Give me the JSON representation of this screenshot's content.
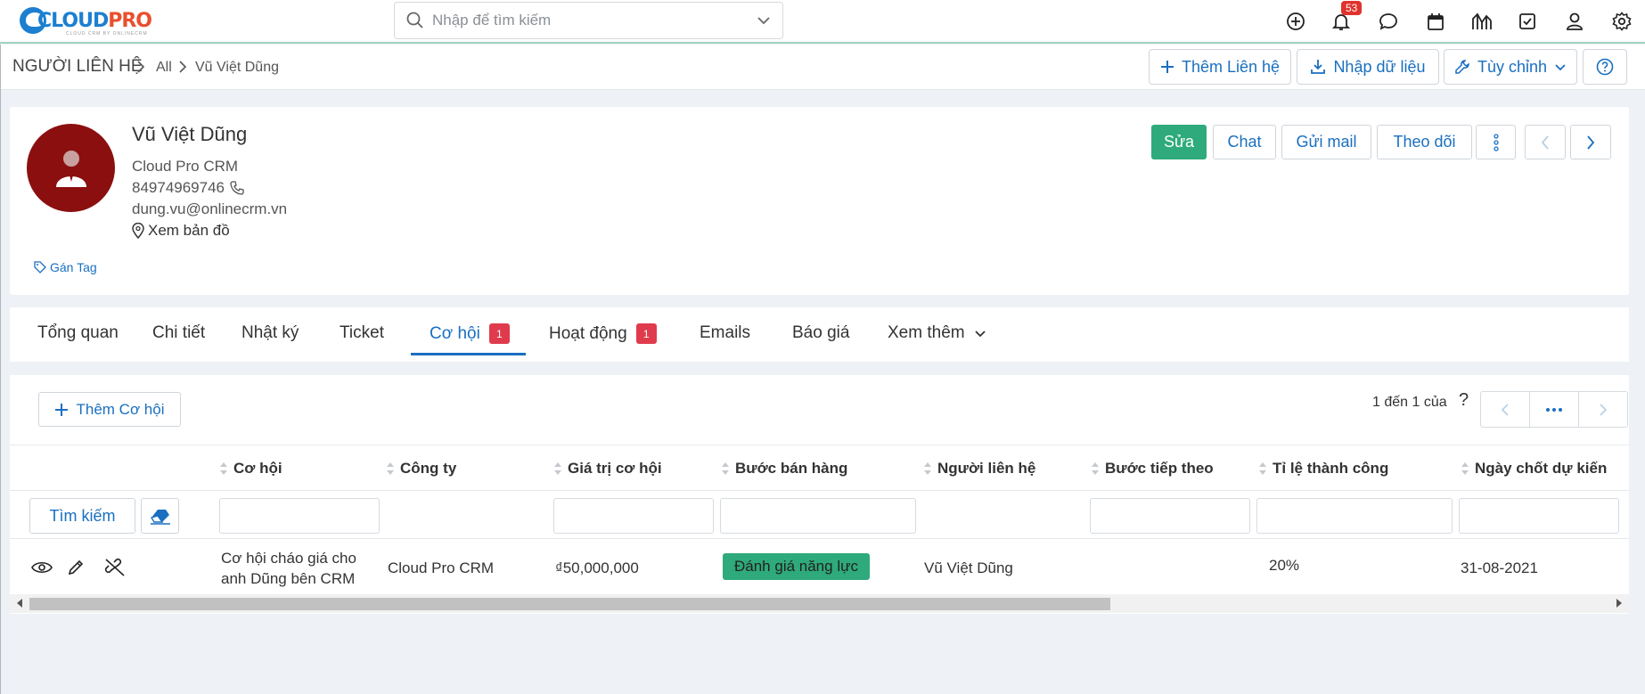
{
  "app": {
    "logo_text_a": "CLOUD",
    "logo_text_b": "PRO",
    "logo_tagline": "CLOUD CRM BY ONLINECRM",
    "brand_colors": {
      "blue": "#1c7fd0",
      "orange": "#e94f2d"
    }
  },
  "search": {
    "placeholder": "Nhập để tìm kiếm"
  },
  "topbar": {
    "icons": [
      "add-circle-icon",
      "bell-icon",
      "chat-bubble-icon",
      "calendar-icon",
      "chart-icon",
      "checkbox-icon",
      "user-icon",
      "settings-icon"
    ],
    "notification_count": "53"
  },
  "breadcrumb": {
    "module": "NGƯỜI LIÊN HỆ",
    "filter": "All",
    "record": "Vũ Việt Dũng"
  },
  "header_actions": {
    "add_contact": "Thêm Liên hệ",
    "import": "Nhập dữ liệu",
    "customize": "Tùy chỉnh"
  },
  "contact": {
    "name": "Vũ Việt Dũng",
    "company": "Cloud Pro CRM",
    "phone": "84974969746",
    "email": "dung.vu@onlinecrm.vn",
    "map": "Xem bản đồ",
    "tag": "Gán Tag",
    "avatar_color": "#8b0f0f"
  },
  "record_actions": {
    "edit": "Sửa",
    "chat": "Chat",
    "send_mail": "Gửi mail",
    "follow": "Theo dõi"
  },
  "tabs": [
    {
      "label": "Tổng quan"
    },
    {
      "label": "Chi tiết"
    },
    {
      "label": "Nhật ký"
    },
    {
      "label": "Ticket"
    },
    {
      "label": "Cơ hội",
      "count": "1",
      "active": true
    },
    {
      "label": "Hoạt động",
      "count": "1"
    },
    {
      "label": "Emails"
    },
    {
      "label": "Báo giá"
    },
    {
      "label": "Xem thêm"
    }
  ],
  "opportunities": {
    "add_label": "Thêm Cơ hội",
    "pagination": "1 đến 1 của",
    "pagination_help": "?",
    "search_label": "Tìm kiếm",
    "columns": [
      "Cơ hội",
      "Công ty",
      "Giá trị cơ hội",
      "Bước bán hàng",
      "Người liên hệ",
      "Bước tiếp theo",
      "Tỉ lệ thành công",
      "Ngày chốt dự kiến"
    ],
    "rows": [
      {
        "name_line1": "Cơ hội cháo giá cho",
        "name_line2": "anh Dũng bên CRM",
        "company": "Cloud Pro CRM",
        "value": "₫50,000,000",
        "stage": "Đánh giá năng lực",
        "contact": "Vũ Việt Dũng",
        "next_step": "",
        "probability": "20%",
        "close_date": "31-08-2021"
      }
    ],
    "stage_color": "#2eaa7c"
  }
}
